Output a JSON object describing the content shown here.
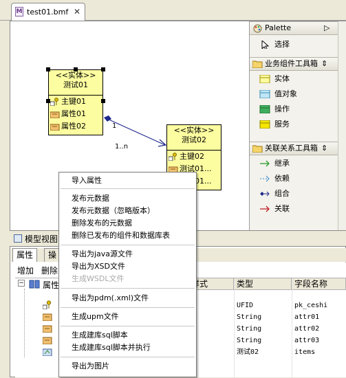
{
  "editor": {
    "tab_label": "test01.bmf",
    "file_icon_letter": "M"
  },
  "entities": [
    {
      "stereotype": "<<实体>>",
      "name": "测试01",
      "attributes": [
        "主键01",
        "属性01",
        "属性02"
      ]
    },
    {
      "stereotype": "<<实体>>",
      "name": "测试02",
      "attributes": [
        "主键02",
        "测试01...",
        "测试01..."
      ]
    }
  ],
  "relation": {
    "source_multiplicity": "1",
    "target_multiplicity": "1..n"
  },
  "palette": {
    "title": "Palette",
    "select_label": "选择",
    "group1": {
      "title": "业务组件工具箱",
      "items": [
        "实体",
        "值对象",
        "操作",
        "服务"
      ]
    },
    "group2": {
      "title": "关联关系工具箱",
      "items": [
        "继承",
        "依赖",
        "组合",
        "关联"
      ]
    }
  },
  "bottom_view": {
    "title": "模型视图",
    "tabs": [
      "属性",
      "操"
    ],
    "toolbar": [
      "增加",
      "删除"
    ],
    "tree_root_label": "属性",
    "columns": [
      "型样式",
      "类型",
      "字段名称"
    ],
    "rows": [
      {
        "style": "GLE",
        "type": "UFID",
        "field": "pk_ceshi"
      },
      {
        "style": "GLE",
        "type": "String",
        "field": "attr01"
      },
      {
        "style": "GLE",
        "type": "String",
        "field": "attr02"
      },
      {
        "style": "GLE",
        "type": "String",
        "field": "attr03"
      },
      {
        "style": "AY",
        "type": "测试02",
        "field": "items"
      }
    ]
  },
  "context_menu": {
    "items": [
      {
        "label": "导入属性",
        "enabled": true
      },
      {
        "label": "发布元数据",
        "enabled": true
      },
      {
        "label": "发布元数据（忽略版本）",
        "enabled": true
      },
      {
        "label": "删除发布的元数据",
        "enabled": true
      },
      {
        "label": "删除已发布的组件和数据库表",
        "enabled": true
      },
      {
        "label": "导出为java源文件",
        "enabled": true
      },
      {
        "label": "导出为XSD文件",
        "enabled": true
      },
      {
        "label": "生成WSDL文件",
        "enabled": false
      },
      {
        "label": "导出为pdm(.xml)文件",
        "enabled": true
      },
      {
        "label": "生成upm文件",
        "enabled": true
      },
      {
        "label": "生成建库sql脚本",
        "enabled": true
      },
      {
        "label": "生成建库sql脚本并执行",
        "enabled": true
      },
      {
        "label": "导出为图片",
        "enabled": true
      }
    ]
  },
  "colors": {
    "entity_fill": "#fcfca0",
    "relation_line": "#1f2a8c",
    "menu_disabled": "#a9a9a9"
  }
}
